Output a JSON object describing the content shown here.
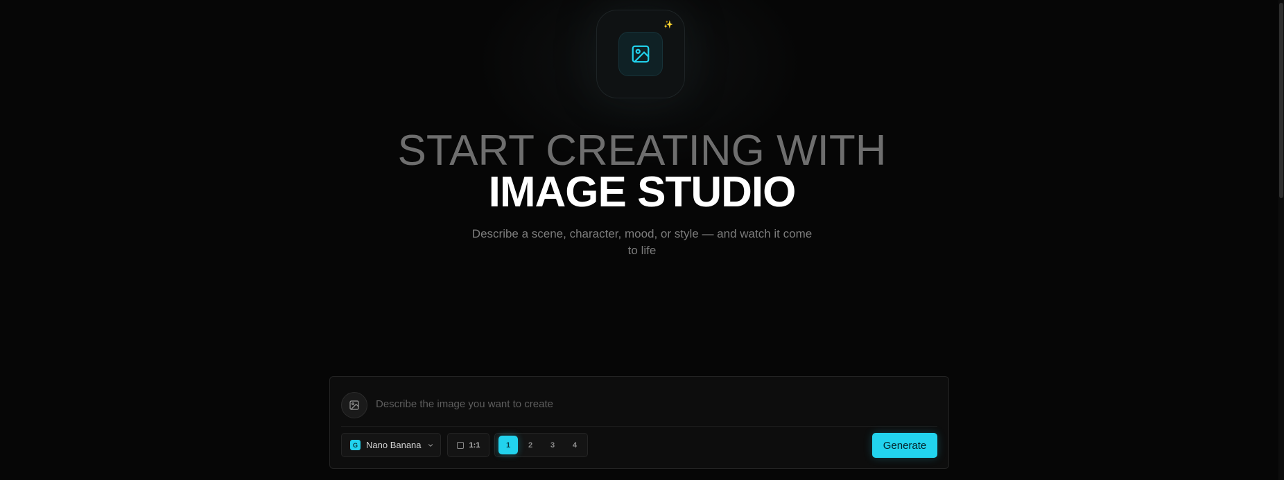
{
  "hero": {
    "icon": "image-icon",
    "sparkle": "✨",
    "headline_line1": "START CREATING WITH",
    "headline_line2": "IMAGE STUDIO",
    "subtitle": "Describe a scene, character, mood, or style — and watch it come to life"
  },
  "prompt": {
    "placeholder": "Describe the image you want to create",
    "value": "",
    "attach_icon": "image-icon"
  },
  "toolbar": {
    "model": {
      "badge": "G",
      "label": "Nano Banana",
      "icon": "chevron-down-icon"
    },
    "aspect_ratio": {
      "icon": "square-icon",
      "label": "1:1"
    },
    "count_options": [
      "1",
      "2",
      "3",
      "4"
    ],
    "count_selected": "1",
    "generate_label": "Generate"
  },
  "colors": {
    "accent": "#22d3ee",
    "background": "#060606",
    "panel": "#0d0d0d",
    "muted_text": "#7c7c7c"
  }
}
